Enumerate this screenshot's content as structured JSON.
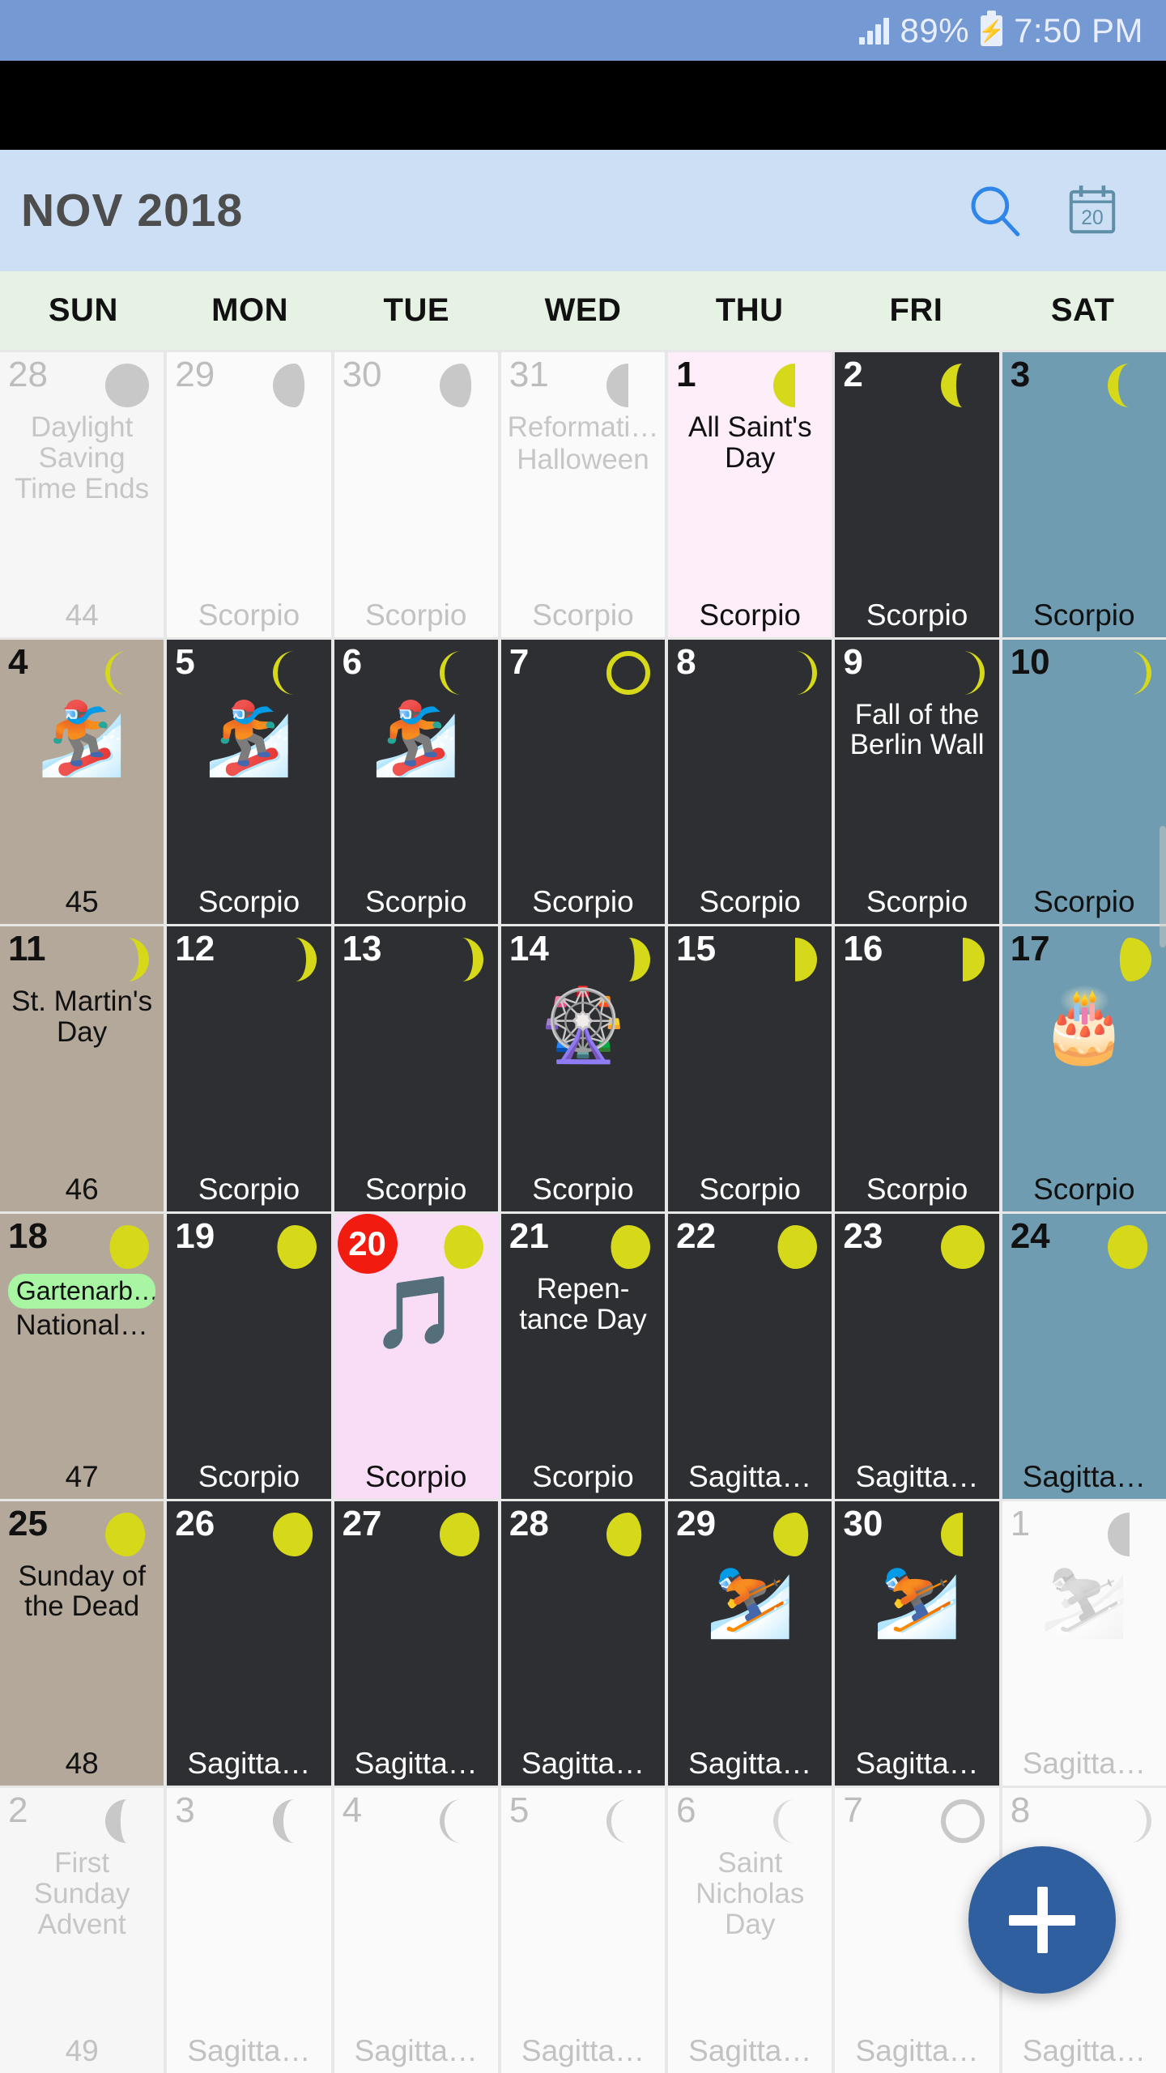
{
  "status_bar": {
    "battery_percent": "89%",
    "time": "7:50 PM",
    "signal_icon": "signal-bars-icon",
    "battery_icon": "battery-charging-icon",
    "background_color": "#7599d2"
  },
  "app_bar": {
    "title": "NOV 2018",
    "search_icon": "search-icon",
    "today_icon": "calendar-today-icon",
    "today_icon_label": "20",
    "background_color": "#ccdff4",
    "accent_color": "#3b82d6"
  },
  "weekdays": [
    "SUN",
    "MON",
    "TUE",
    "WED",
    "THU",
    "FRI",
    "SAT"
  ],
  "fab": {
    "label": "+",
    "name": "add-event-button",
    "color": "#2f5f9e"
  },
  "colors": {
    "sunday_cell": "#b3a899",
    "saturday_cell": "#6f9cb0",
    "weekday_cell": "#2e2f33",
    "holiday_cell": "#fdeefa",
    "selected_cell": "#f9ddf6",
    "other_month_cell": "#f6f6f6",
    "today_badge": "#f11b0f",
    "moon_yellow": "#d6d81a",
    "event_chip": "#a8f5a4"
  },
  "weeks": [
    {
      "week_number": "44",
      "days": [
        {
          "num": "28",
          "style": "other",
          "numStyle": "muted",
          "moon": "full-muted",
          "moonColor": "#c8c8c8",
          "events": [
            {
              "type": "text",
              "text": "Daylight Saving Time Ends"
            }
          ],
          "bottom": "44",
          "bottomStyle": "on-muted"
        },
        {
          "num": "29",
          "style": "other-alt",
          "numStyle": "muted",
          "moon": "gibbous-waning-muted",
          "moonColor": "#c8c8c8",
          "events": [],
          "bottom": "Scorpio",
          "bottomStyle": "on-muted"
        },
        {
          "num": "30",
          "style": "other-alt",
          "numStyle": "muted",
          "moon": "gibbous-waning-muted",
          "moonColor": "#c8c8c8",
          "events": [],
          "bottom": "Scorpio",
          "bottomStyle": "on-muted"
        },
        {
          "num": "31",
          "style": "other-alt",
          "numStyle": "muted",
          "moon": "half-waning-muted",
          "moonColor": "#c8c8c8",
          "events": [
            {
              "type": "text",
              "text": "Reformati…"
            },
            {
              "type": "text",
              "text": "Halloween"
            }
          ],
          "bottom": "Scorpio",
          "bottomStyle": "on-muted"
        },
        {
          "num": "1",
          "style": "thu-pink",
          "numStyle": "dark",
          "moon": "half-waning",
          "moonColor": "#d6d81a",
          "events": [
            {
              "type": "text",
              "text": "All Saint's Day",
              "tone": "on-light"
            }
          ],
          "bottom": "Scorpio",
          "bottomStyle": "on-light"
        },
        {
          "num": "2",
          "style": "weekday-c",
          "numStyle": "light",
          "moon": "crescent-waning-wide",
          "moonColor": "#d6d81a",
          "events": [],
          "bottom": "Scorpio",
          "bottomStyle": "on-dark"
        },
        {
          "num": "3",
          "style": "saturday-c",
          "numStyle": "dark",
          "moon": "crescent-waning",
          "moonColor": "#d6d81a",
          "events": [],
          "bottom": "Scorpio",
          "bottomStyle": "on-light"
        }
      ]
    },
    {
      "week_number": "45",
      "days": [
        {
          "num": "4",
          "style": "sunday-c",
          "numStyle": "dark",
          "moon": "crescent-waning-thin",
          "moonColor": "#d6d81a",
          "events": [
            {
              "type": "emoji",
              "text": "🏂"
            }
          ],
          "bottom": "45",
          "bottomStyle": "on-light"
        },
        {
          "num": "5",
          "style": "weekday-c",
          "numStyle": "light",
          "moon": "crescent-waning-thin",
          "moonColor": "#d6d81a",
          "events": [
            {
              "type": "emoji",
              "text": "🏂"
            }
          ],
          "bottom": "Scorpio",
          "bottomStyle": "on-dark"
        },
        {
          "num": "6",
          "style": "weekday-c",
          "numStyle": "light",
          "moon": "crescent-waning-thin",
          "moonColor": "#d6d81a",
          "events": [
            {
              "type": "emoji",
              "text": "🏂"
            }
          ],
          "bottom": "Scorpio",
          "bottomStyle": "on-dark"
        },
        {
          "num": "7",
          "style": "weekday-c",
          "numStyle": "light",
          "moon": "new-moon",
          "moonColor": "#d6d81a",
          "events": [],
          "bottom": "Scorpio",
          "bottomStyle": "on-dark"
        },
        {
          "num": "8",
          "style": "weekday-c",
          "numStyle": "light",
          "moon": "crescent-waxing-thin",
          "moonColor": "#d6d81a",
          "events": [],
          "bottom": "Scorpio",
          "bottomStyle": "on-dark"
        },
        {
          "num": "9",
          "style": "weekday-c",
          "numStyle": "light",
          "moon": "crescent-waxing-thin",
          "moonColor": "#d6d81a",
          "events": [
            {
              "type": "text",
              "text": "Fall of the Berlin Wall",
              "tone": "on-dark"
            }
          ],
          "bottom": "Scorpio",
          "bottomStyle": "on-dark"
        },
        {
          "num": "10",
          "style": "saturday-c",
          "numStyle": "dark",
          "moon": "crescent-waxing-thin",
          "moonColor": "#d6d81a",
          "events": [],
          "bottom": "Scorpio",
          "bottomStyle": "on-light"
        }
      ]
    },
    {
      "week_number": "46",
      "days": [
        {
          "num": "11",
          "style": "sunday-c",
          "numStyle": "dark",
          "moon": "crescent-waxing",
          "moonColor": "#d6d81a",
          "events": [
            {
              "type": "text",
              "text": "St. Martin's Day",
              "tone": "on-light"
            }
          ],
          "bottom": "46",
          "bottomStyle": "on-light"
        },
        {
          "num": "12",
          "style": "weekday-c",
          "numStyle": "light",
          "moon": "crescent-waxing",
          "moonColor": "#d6d81a",
          "events": [],
          "bottom": "Scorpio",
          "bottomStyle": "on-dark"
        },
        {
          "num": "13",
          "style": "weekday-c",
          "numStyle": "light",
          "moon": "crescent-waxing",
          "moonColor": "#d6d81a",
          "events": [],
          "bottom": "Scorpio",
          "bottomStyle": "on-dark"
        },
        {
          "num": "14",
          "style": "weekday-c",
          "numStyle": "light",
          "moon": "crescent-waxing-wide",
          "moonColor": "#d6d81a",
          "events": [
            {
              "type": "emoji",
              "text": "🎡"
            }
          ],
          "bottom": "Scorpio",
          "bottomStyle": "on-dark"
        },
        {
          "num": "15",
          "style": "weekday-c",
          "numStyle": "light",
          "moon": "half-waxing",
          "moonColor": "#d6d81a",
          "events": [],
          "bottom": "Scorpio",
          "bottomStyle": "on-dark"
        },
        {
          "num": "16",
          "style": "weekday-c",
          "numStyle": "light",
          "moon": "half-waxing",
          "moonColor": "#d6d81a",
          "events": [],
          "bottom": "Scorpio",
          "bottomStyle": "on-dark"
        },
        {
          "num": "17",
          "style": "saturday-c",
          "numStyle": "dark",
          "moon": "gibbous-waxing",
          "moonColor": "#d6d81a",
          "events": [
            {
              "type": "emoji",
              "text": "🎂"
            }
          ],
          "bottom": "Scorpio",
          "bottomStyle": "on-light"
        }
      ]
    },
    {
      "week_number": "47",
      "days": [
        {
          "num": "18",
          "style": "sunday-c",
          "numStyle": "dark",
          "moon": "gibbous-waxing-round",
          "moonColor": "#d6d81a",
          "events": [
            {
              "type": "chip",
              "text": "Gartenarb…"
            },
            {
              "type": "text",
              "text": "National…",
              "tone": "on-light"
            }
          ],
          "bottom": "47",
          "bottomStyle": "on-light"
        },
        {
          "num": "19",
          "style": "weekday-c",
          "numStyle": "light",
          "moon": "gibbous-waxing-round",
          "moonColor": "#d6d81a",
          "events": [],
          "bottom": "Scorpio",
          "bottomStyle": "on-dark"
        },
        {
          "num": "20",
          "style": "sel-pink",
          "numStyle": "today",
          "moon": "gibbous-waxing-round",
          "moonColor": "#d6d81a",
          "events": [
            {
              "type": "emoji",
              "text": "🎵"
            }
          ],
          "bottom": "Scorpio",
          "bottomStyle": "on-light"
        },
        {
          "num": "21",
          "style": "weekday-c",
          "numStyle": "light",
          "moon": "gibbous-waxing-round",
          "moonColor": "#d6d81a",
          "events": [
            {
              "type": "text",
              "text": "Repen-tance Day",
              "tone": "on-dark"
            }
          ],
          "bottom": "Scorpio",
          "bottomStyle": "on-dark"
        },
        {
          "num": "22",
          "style": "weekday-c",
          "numStyle": "light",
          "moon": "gibbous-waxing-round",
          "moonColor": "#d6d81a",
          "events": [],
          "bottom": "Sagitta…",
          "bottomStyle": "on-dark"
        },
        {
          "num": "23",
          "style": "weekday-c",
          "numStyle": "light",
          "moon": "full",
          "moonColor": "#d6d81a",
          "events": [],
          "bottom": "Sagitta…",
          "bottomStyle": "on-dark"
        },
        {
          "num": "24",
          "style": "saturday-c",
          "numStyle": "dark",
          "moon": "gibbous-waning-round",
          "moonColor": "#d6d81a",
          "events": [],
          "bottom": "Sagitta…",
          "bottomStyle": "on-light"
        }
      ]
    },
    {
      "week_number": "48",
      "days": [
        {
          "num": "25",
          "style": "sunday-c",
          "numStyle": "dark",
          "moon": "gibbous-waning-round",
          "moonColor": "#d6d81a",
          "events": [
            {
              "type": "text",
              "text": "Sunday of the Dead",
              "tone": "on-light"
            }
          ],
          "bottom": "48",
          "bottomStyle": "on-light"
        },
        {
          "num": "26",
          "style": "weekday-c",
          "numStyle": "light",
          "moon": "gibbous-waning-round",
          "moonColor": "#d6d81a",
          "events": [],
          "bottom": "Sagitta…",
          "bottomStyle": "on-dark"
        },
        {
          "num": "27",
          "style": "weekday-c",
          "numStyle": "light",
          "moon": "gibbous-waning-round",
          "moonColor": "#d6d81a",
          "events": [],
          "bottom": "Sagitta…",
          "bottomStyle": "on-dark"
        },
        {
          "num": "28",
          "style": "weekday-c",
          "numStyle": "light",
          "moon": "gibbous-waning2",
          "moonColor": "#d6d81a",
          "events": [],
          "bottom": "Sagitta…",
          "bottomStyle": "on-dark"
        },
        {
          "num": "29",
          "style": "weekday-c",
          "numStyle": "light",
          "moon": "gibbous-waning2",
          "moonColor": "#d6d81a",
          "events": [
            {
              "type": "emoji",
              "text": "⛷️"
            }
          ],
          "bottom": "Sagitta…",
          "bottomStyle": "on-dark"
        },
        {
          "num": "30",
          "style": "weekday-c",
          "numStyle": "light",
          "moon": "half-waning",
          "moonColor": "#d6d81a",
          "events": [
            {
              "type": "emoji",
              "text": "⛷️"
            }
          ],
          "bottom": "Sagitta…",
          "bottomStyle": "on-dark"
        },
        {
          "num": "1",
          "style": "other-alt",
          "numStyle": "muted",
          "moon": "half-waning-muted",
          "moonColor": "#c8c8c8",
          "events": [
            {
              "type": "emoji",
              "text": "⛷️",
              "gray": true
            }
          ],
          "bottom": "Sagitta…",
          "bottomStyle": "on-muted"
        }
      ]
    },
    {
      "week_number": "49",
      "days": [
        {
          "num": "2",
          "style": "other",
          "numStyle": "muted",
          "moon": "crescent-waning-wide-muted",
          "moonColor": "#c8c8c8",
          "events": [
            {
              "type": "text",
              "text": "First Sunday Advent",
              "tone": "on-muted"
            }
          ],
          "bottom": "49",
          "bottomStyle": "on-muted"
        },
        {
          "num": "3",
          "style": "other-alt",
          "numStyle": "muted",
          "moon": "crescent-waning-muted",
          "moonColor": "#c8c8c8",
          "events": [],
          "bottom": "Sagitta…",
          "bottomStyle": "on-muted"
        },
        {
          "num": "4",
          "style": "other-alt",
          "numStyle": "muted",
          "moon": "crescent-waning-thin-muted",
          "moonColor": "#c8c8c8",
          "events": [],
          "bottom": "Sagitta…",
          "bottomStyle": "on-muted"
        },
        {
          "num": "5",
          "style": "other-alt",
          "numStyle": "muted",
          "moon": "crescent-waning-thin-muted",
          "moonColor": "#cfcfcf",
          "events": [],
          "bottom": "Sagitta…",
          "bottomStyle": "on-muted"
        },
        {
          "num": "6",
          "style": "other-alt",
          "numStyle": "muted",
          "moon": "crescent-waning-thin-muted",
          "moonColor": "#d8d8d8",
          "events": [
            {
              "type": "text",
              "text": "Saint Nicholas Day",
              "tone": "on-muted"
            }
          ],
          "bottom": "Sagitta…",
          "bottomStyle": "on-muted"
        },
        {
          "num": "7",
          "style": "other-alt",
          "numStyle": "muted",
          "moon": "new-moon-muted",
          "moonColor": "#c8c8c8",
          "events": [],
          "bottom": "Sagitta…",
          "bottomStyle": "on-muted"
        },
        {
          "num": "8",
          "style": "other-alt",
          "numStyle": "muted",
          "moon": "crescent-waxing-thin-muted",
          "moonColor": "#d8d8d8",
          "events": [],
          "bottom": "Sagitta…",
          "bottomStyle": "on-muted"
        }
      ]
    }
  ]
}
